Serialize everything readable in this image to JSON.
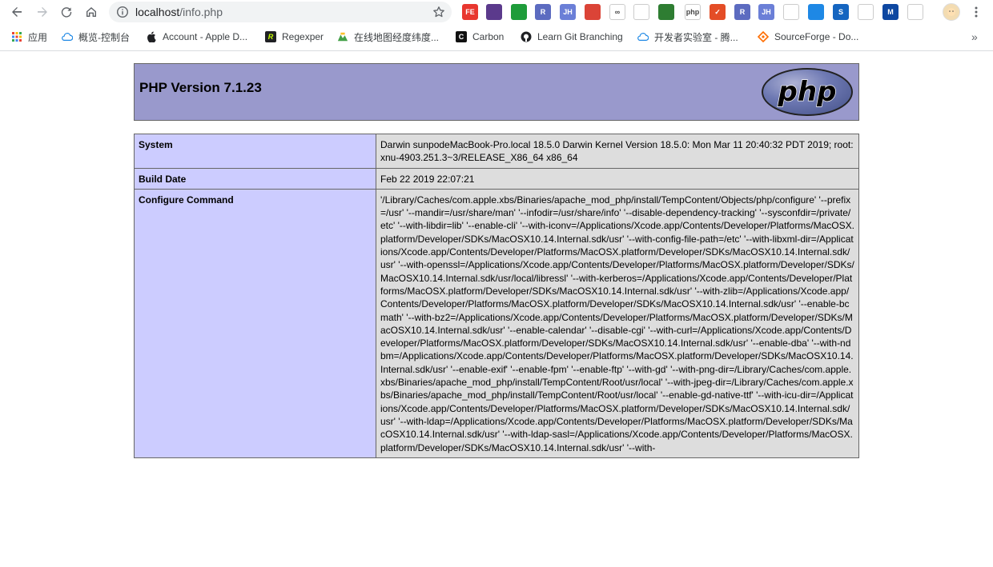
{
  "browser": {
    "url_host": "localhost",
    "url_path": "/info.php",
    "extensions": [
      {
        "name": "fe-extension-icon",
        "label": "FE",
        "color": "#e8372f"
      },
      {
        "name": "purple-extension-icon",
        "label": "",
        "color": "#5b3a8c"
      },
      {
        "name": "green-square-extension-icon",
        "label": "",
        "color": "#1e9c3a"
      },
      {
        "name": "r-badge-extension-icon",
        "label": "R",
        "color": "#5c6bc0"
      },
      {
        "name": "jh-extension-icon",
        "label": "JH",
        "color": "#6b7fd7"
      },
      {
        "name": "chrome-icon",
        "label": "",
        "color": "#db4437"
      },
      {
        "name": "infinity-icon",
        "label": "∞",
        "color": "#ffffff"
      },
      {
        "name": "shield-extension-icon",
        "label": "",
        "color": "#ffffff"
      },
      {
        "name": "green-leaf-extension-icon",
        "label": "",
        "color": "#2e7d32"
      },
      {
        "name": "php-extension-icon",
        "label": "php",
        "color": "#ffffff"
      },
      {
        "name": "red-checkbox-extension-icon",
        "label": "✓",
        "color": "#e44d26"
      },
      {
        "name": "r-badge-2-extension-icon",
        "label": "R",
        "color": "#5c6bc0"
      },
      {
        "name": "jh-2-extension-icon",
        "label": "JH",
        "color": "#6b7fd7"
      },
      {
        "name": "snake-extension-icon",
        "label": "",
        "color": "#ffffff"
      },
      {
        "name": "book-extension-icon",
        "label": "",
        "color": "#1e88e5"
      },
      {
        "name": "s-extension-icon",
        "label": "S",
        "color": "#1565c0"
      },
      {
        "name": "crop-extension-icon",
        "label": "",
        "color": "#ffffff"
      },
      {
        "name": "m-extension-icon",
        "label": "M",
        "color": "#0d47a1"
      },
      {
        "name": "globe-extension-icon",
        "label": "",
        "color": "#ffffff"
      }
    ],
    "bookmarks": [
      {
        "name": "bookmark-apps",
        "label": "应用",
        "icon": "apps-grid-icon"
      },
      {
        "name": "bookmark-console",
        "label": "概览-控制台",
        "icon": "cloud-icon"
      },
      {
        "name": "bookmark-apple",
        "label": "Account - Apple D...",
        "icon": "apple-icon"
      },
      {
        "name": "bookmark-regexper",
        "label": "Regexper",
        "icon": "r-icon"
      },
      {
        "name": "bookmark-map",
        "label": "在线地图经度纬度...",
        "icon": "map-icon"
      },
      {
        "name": "bookmark-carbon",
        "label": "Carbon",
        "icon": "c-icon"
      },
      {
        "name": "bookmark-git",
        "label": "Learn Git Branching",
        "icon": "github-icon"
      },
      {
        "name": "bookmark-lab",
        "label": "开发者实验室 - 腾...",
        "icon": "cloud-icon"
      },
      {
        "name": "bookmark-sourceforge",
        "label": "SourceForge - Do...",
        "icon": "sourceforge-icon"
      }
    ],
    "more_bookmarks": "»"
  },
  "php": {
    "title": "PHP Version 7.1.23",
    "logo_text": "php",
    "rows": [
      {
        "key": "System",
        "value": "Darwin sunpodeMacBook-Pro.local 18.5.0 Darwin Kernel Version 18.5.0: Mon Mar 11 20:40:32 PDT 2019; root:xnu-4903.251.3~3/RELEASE_X86_64 x86_64"
      },
      {
        "key": "Build Date",
        "value": "Feb 22 2019 22:07:21"
      },
      {
        "key": "Configure Command",
        "value": "'/Library/Caches/com.apple.xbs/Binaries/apache_mod_php/install/TempContent/Objects/php/configure' '--prefix=/usr' '--mandir=/usr/share/man' '--infodir=/usr/share/info' '--disable-dependency-tracking' '--sysconfdir=/private/etc' '--with-libdir=lib' '--enable-cli' '--with-iconv=/Applications/Xcode.app/Contents/Developer/Platforms/MacOSX.platform/Developer/SDKs/MacOSX10.14.Internal.sdk/usr' '--with-config-file-path=/etc' '--with-libxml-dir=/Applications/Xcode.app/Contents/Developer/Platforms/MacOSX.platform/Developer/SDKs/MacOSX10.14.Internal.sdk/usr' '--with-openssl=/Applications/Xcode.app/Contents/Developer/Platforms/MacOSX.platform/Developer/SDKs/MacOSX10.14.Internal.sdk/usr/local/libressl' '--with-kerberos=/Applications/Xcode.app/Contents/Developer/Platforms/MacOSX.platform/Developer/SDKs/MacOSX10.14.Internal.sdk/usr' '--with-zlib=/Applications/Xcode.app/Contents/Developer/Platforms/MacOSX.platform/Developer/SDKs/MacOSX10.14.Internal.sdk/usr' '--enable-bcmath' '--with-bz2=/Applications/Xcode.app/Contents/Developer/Platforms/MacOSX.platform/Developer/SDKs/MacOSX10.14.Internal.sdk/usr' '--enable-calendar' '--disable-cgi' '--with-curl=/Applications/Xcode.app/Contents/Developer/Platforms/MacOSX.platform/Developer/SDKs/MacOSX10.14.Internal.sdk/usr' '--enable-dba' '--with-ndbm=/Applications/Xcode.app/Contents/Developer/Platforms/MacOSX.platform/Developer/SDKs/MacOSX10.14.Internal.sdk/usr' '--enable-exif' '--enable-fpm' '--enable-ftp' '--with-gd' '--with-png-dir=/Library/Caches/com.apple.xbs/Binaries/apache_mod_php/install/TempContent/Root/usr/local' '--with-jpeg-dir=/Library/Caches/com.apple.xbs/Binaries/apache_mod_php/install/TempContent/Root/usr/local' '--enable-gd-native-ttf' '--with-icu-dir=/Applications/Xcode.app/Contents/Developer/Platforms/MacOSX.platform/Developer/SDKs/MacOSX10.14.Internal.sdk/usr' '--with-ldap=/Applications/Xcode.app/Contents/Developer/Platforms/MacOSX.platform/Developer/SDKs/MacOSX10.14.Internal.sdk/usr' '--with-ldap-sasl=/Applications/Xcode.app/Contents/Developer/Platforms/MacOSX.platform/Developer/SDKs/MacOSX10.14.Internal.sdk/usr' '--with-"
      }
    ]
  },
  "colors": {
    "header_bg": "#9999cc",
    "key_bg": "#ccccff",
    "value_bg": "#dddddd",
    "border": "#666666"
  }
}
